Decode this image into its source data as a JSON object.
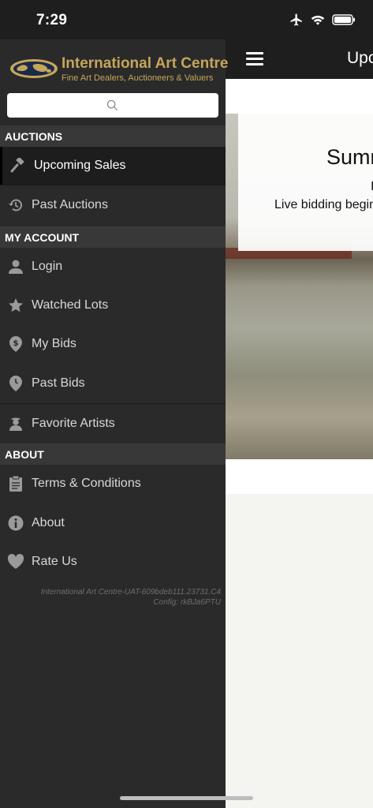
{
  "status": {
    "time": "7:29",
    "icons": [
      "airplane-icon",
      "wifi-icon",
      "battery-icon"
    ]
  },
  "main": {
    "title": "Upcoming Sales",
    "hero": {
      "title": "Summer",
      "line2": "I",
      "line3": "Live bidding begins"
    }
  },
  "drawer": {
    "logo": {
      "name": "International Art Centre",
      "tagline": "Fine Art Dealers, Auctioneers & Valuers"
    },
    "search": {
      "placeholder": ""
    },
    "sections": {
      "auctions": "AUCTIONS",
      "my_account": "MY ACCOUNT",
      "about": "ABOUT"
    },
    "items": {
      "upcoming_sales": "Upcoming Sales",
      "past_auctions": "Past Auctions",
      "login": "Login",
      "watched_lots": "Watched Lots",
      "my_bids": "My Bids",
      "past_bids": "Past Bids",
      "favorite_artists": "Favorite Artists",
      "terms": "Terms & Conditions",
      "about": "About",
      "rate_us": "Rate Us"
    },
    "version_line1": "International Art Centre-UAT-609bdeb111.23731.C4",
    "version_line2": "Config: rkBJa6PTU"
  },
  "colors": {
    "drawer_bg": "#2a2a2a",
    "section_bg": "#383838",
    "active_bg": "#1d1d1d",
    "brand_gold": "#c5a65a"
  }
}
